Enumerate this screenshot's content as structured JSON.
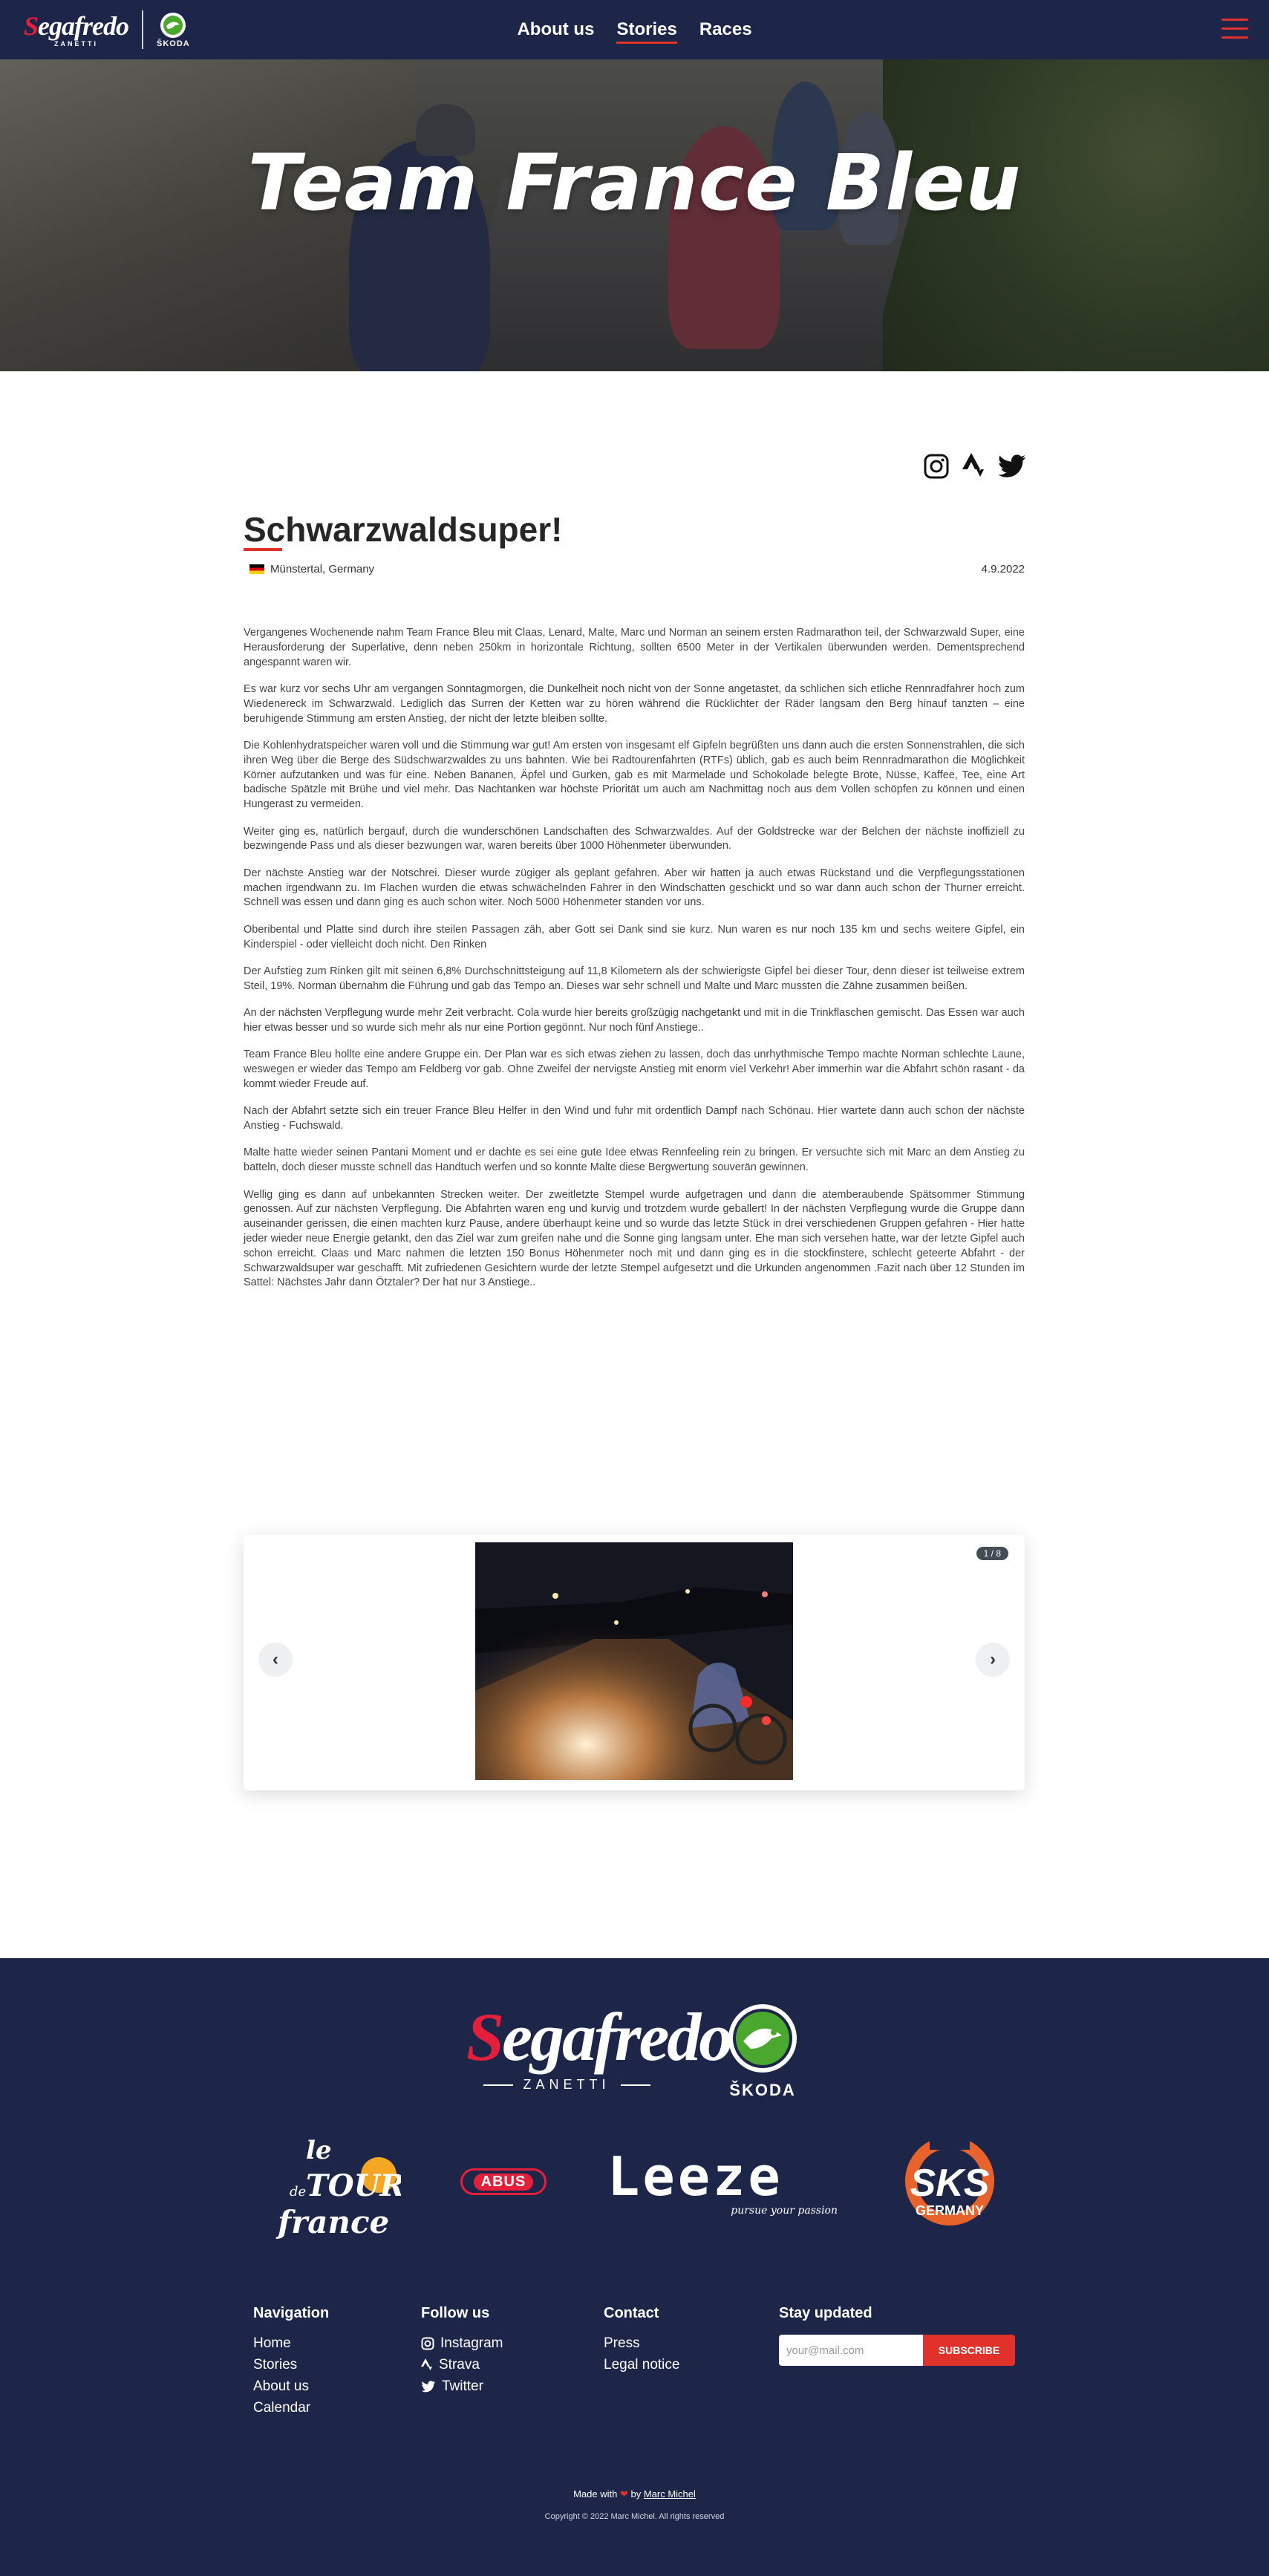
{
  "header": {
    "brand_main": "Segafredo",
    "brand_sub": "ZANETTI",
    "partner": "ŠKODA",
    "nav": [
      {
        "label": "About us",
        "active": false
      },
      {
        "label": "Stories",
        "active": true
      },
      {
        "label": "Races",
        "active": false
      }
    ]
  },
  "hero": {
    "title": "Team France Bleu"
  },
  "article": {
    "title": "Schwarzwaldsuper!",
    "location": "Münstertal,  Germany",
    "date": "4.9.2022",
    "paragraphs": [
      "Vergangenes Wochenende nahm Team France Bleu mit Claas, Lenard, Malte, Marc und Norman an seinem ersten Radmarathon teil, der Schwarzwald Super, eine Herausforderung der Superlative, denn neben 250km in horizontale Richtung, sollten 6500 Meter in der Vertikalen überwunden werden. Dementsprechend angespannt waren wir.",
      "Es war kurz vor sechs Uhr am vergangen Sonntagmorgen, die Dunkelheit noch nicht von der Sonne angetastet, da schlichen sich etliche Rennradfahrer hoch zum Wiedenereck im Schwarzwald. Lediglich das Surren der Ketten war zu hören während die Rücklichter der Räder langsam den Berg hinauf tanzten – eine beruhigende Stimmung am ersten Anstieg, der nicht der letzte bleiben sollte.",
      "Die Kohlenhydratspeicher waren voll und die Stimmung war gut! Am ersten von insgesamt elf Gipfeln begrüßten uns dann auch die ersten Sonnenstrahlen, die sich ihren Weg über die Berge des Südschwarzwaldes zu uns bahnten. Wie bei Radtourenfahrten (RTFs) üblich, gab es auch beim Rennradmarathon die Möglichkeit Körner aufzutanken und was für eine. Neben Bananen, Äpfel und Gurken, gab es mit Marmelade und Schokolade belegte Brote, Nüsse, Kaffee, Tee, eine Art badische Spätzle mit Brühe und viel mehr. Das Nachtanken war höchste Priorität um auch am Nachmittag noch aus dem Vollen schöpfen zu können und einen Hungerast zu vermeiden.",
      "Weiter ging es, natürlich bergauf, durch die wunderschönen Landschaften des Schwarzwaldes. Auf der Goldstrecke war der Belchen der nächste inoffiziell zu bezwingende Pass und als dieser bezwungen war, waren bereits über 1000 Höhenmeter überwunden.",
      "Der nächste Anstieg war der Notschrei. Dieser wurde zügiger als geplant gefahren. Aber wir hatten ja auch etwas Rückstand und die Verpflegungsstationen machen irgendwann zu. Im Flachen wurden die etwas schwächelnden Fahrer in den Windschatten geschickt und so war dann auch schon der Thurner erreicht. Schnell was essen und dann ging es auch schon witer. Noch 5000 Höhenmeter standen vor uns.",
      "Oberibental und Platte sind durch ihre steilen Passagen zäh, aber Gott sei Dank sind sie kurz. Nun waren es nur noch 135 km und sechs weitere Gipfel, ein Kinderspiel - oder vielleicht doch nicht. Den Rinken",
      "Der Aufstieg zum Rinken gilt mit seinen 6,8% Durchschnittsteigung auf 11,8 Kilometern als der schwierigste Gipfel bei dieser Tour, denn dieser ist teilweise extrem Steil, 19%. Norman übernahm die Führung und gab das Tempo an. Dieses war sehr schnell und Malte und Marc mussten die Zähne zusammen beißen.",
      "An der nächsten Verpflegung wurde mehr Zeit verbracht. Cola wurde hier bereits großzügig nachgetankt und mit in die Trinkflaschen gemischt. Das Essen war auch hier etwas besser und so wurde sich mehr als nur eine Portion gegönnt. Nur noch fünf Anstiege..",
      "Team France Bleu hollte eine andere Gruppe ein. Der Plan war es sich etwas ziehen zu lassen, doch das unrhythmische Tempo machte Norman schlechte Laune, weswegen er wieder das Tempo am Feldberg vor gab. Ohne Zweifel der nervigste Anstieg mit enorm viel Verkehr! Aber immerhin war die Abfahrt schön rasant - da kommt wieder Freude auf.",
      "Nach der Abfahrt setzte sich ein treuer France Bleu Helfer in den Wind und fuhr mit ordentlich Dampf nach Schönau. Hier wartete dann auch schon der nächste Anstieg - Fuchswald.",
      "Malte hatte wieder seinen Pantani Moment und er dachte es sei eine gute Idee etwas Rennfeeling rein zu bringen. Er versuchte sich mit Marc an dem Anstieg zu batteln, doch dieser musste schnell das Handtuch werfen und so konnte Malte diese Bergwertung souverän gewinnen.",
      "Wellig ging es dann auf unbekannten Strecken weiter. Der zweitletzte Stempel wurde aufgetragen und dann die atemberaubende Spätsommer Stimmung genossen. Auf zur nächsten Verpflegung. Die Abfahrten waren eng und kurvig und trotzdem wurde geballert! In der nächsten Verpflegung wurde die Gruppe dann auseinander gerissen, die einen machten kurz Pause, andere überhaupt keine und so wurde das letzte Stück in drei verschiedenen Gruppen gefahren - Hier hatte jeder wieder neue Energie getankt, den das Ziel war zum greifen nahe und die Sonne ging langsam unter. Ehe man sich versehen hatte, war der letzte Gipfel auch schon erreicht. Claas und Marc nahmen die letzten 150 Bonus Höhenmeter noch mit und dann ging es in die stockfinstere, schlecht geteerte Abfahrt - der Schwarzwaldsuper war geschafft. Mit zufriedenen Gesichtern wurde der letzte Stempel aufgesetzt und die Urkunden angenommen .Fazit nach über 12 Stunden im Sattel: Nächstes Jahr dann Ötztaler? Der hat nur 3 Anstiege.."
    ],
    "gallery": {
      "counter": "1 / 8"
    }
  },
  "social_icons": [
    "instagram-icon",
    "strava-icon",
    "twitter-icon"
  ],
  "footer": {
    "main_sponsor": "Segafredo",
    "main_sponsor_sub": "ZANETTI",
    "partner": "ŠKODA",
    "sponsors": {
      "tdf_le": "le",
      "tdf_de": "de",
      "tdf_tour": "TOUR",
      "tdf_france": "france",
      "abus": "ABUS",
      "leeze": "Leeze",
      "leeze_tag": "pursue your passion",
      "sks": "SKS",
      "sks_sub": "GERMANY"
    },
    "columns": {
      "navigation": {
        "heading": "Navigation",
        "links": [
          "Home",
          "Stories",
          "About us",
          "Calendar"
        ]
      },
      "follow": {
        "heading": "Follow us",
        "links": [
          "Instagram",
          "Strava",
          "Twitter"
        ]
      },
      "contact": {
        "heading": "Contact",
        "links": [
          "Press",
          "Legal notice"
        ]
      },
      "newsletter": {
        "heading": "Stay updated",
        "placeholder": "your@mail.com",
        "button": "SUBSCRIBE"
      }
    },
    "made_with": "Made with",
    "made_by": "by",
    "author": "Marc Michel",
    "copyright": "Copyright © 2022 Marc Michel. All rights reserved"
  },
  "colors": {
    "navy": "#1d2648",
    "accent": "#e0312b",
    "segafredo_red": "#e31f3b",
    "skoda_green": "#4ba82e"
  }
}
